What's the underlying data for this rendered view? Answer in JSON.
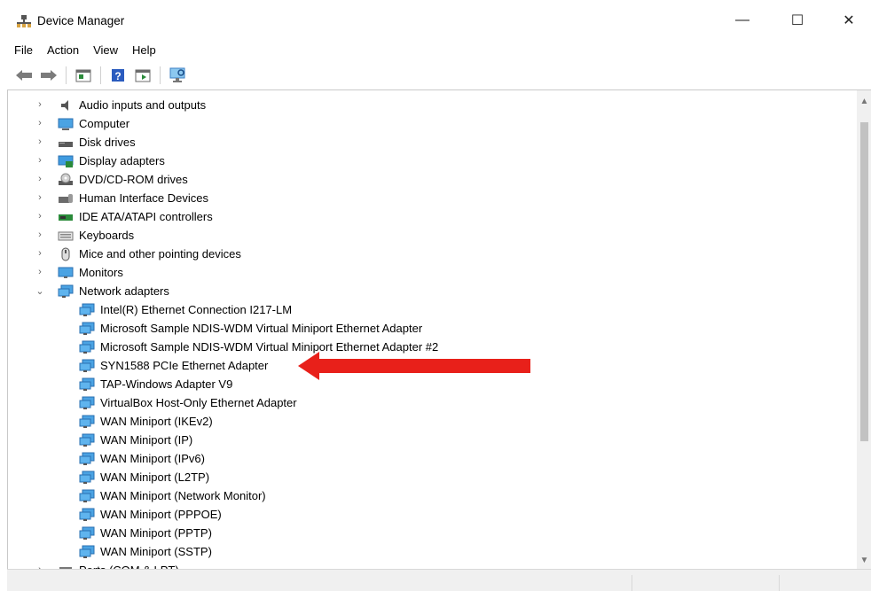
{
  "window": {
    "title": "Device Manager",
    "controls": {
      "minimize": "—",
      "maximize": "☐",
      "close": "✕"
    }
  },
  "menu": [
    "File",
    "Action",
    "View",
    "Help"
  ],
  "toolbar": {
    "buttons": [
      "back-icon",
      "forward-icon",
      "properties-icon",
      "help-icon",
      "update-driver-icon",
      "scan-hardware-icon"
    ]
  },
  "tree": {
    "categories": [
      {
        "label": "Audio inputs and outputs",
        "icon": "speaker-icon",
        "expanded": false
      },
      {
        "label": "Computer",
        "icon": "computer-icon",
        "expanded": false
      },
      {
        "label": "Disk drives",
        "icon": "disk-drive-icon",
        "expanded": false
      },
      {
        "label": "Display adapters",
        "icon": "display-adapter-icon",
        "expanded": false
      },
      {
        "label": "DVD/CD-ROM drives",
        "icon": "dvd-drive-icon",
        "expanded": false
      },
      {
        "label": "Human Interface Devices",
        "icon": "hid-icon",
        "expanded": false
      },
      {
        "label": "IDE ATA/ATAPI controllers",
        "icon": "ide-controller-icon",
        "expanded": false
      },
      {
        "label": "Keyboards",
        "icon": "keyboard-icon",
        "expanded": false
      },
      {
        "label": "Mice and other pointing devices",
        "icon": "mouse-icon",
        "expanded": false
      },
      {
        "label": "Monitors",
        "icon": "monitor-icon",
        "expanded": false
      },
      {
        "label": "Network adapters",
        "icon": "network-adapter-icon",
        "expanded": true
      }
    ],
    "network_adapters": [
      "Intel(R) Ethernet Connection I217-LM",
      "Microsoft Sample NDIS-WDM Virtual Miniport Ethernet Adapter",
      "Microsoft Sample NDIS-WDM Virtual Miniport Ethernet Adapter #2",
      "SYN1588 PCIe Ethernet Adapter",
      "TAP-Windows Adapter V9",
      "VirtualBox Host-Only Ethernet Adapter",
      "WAN Miniport (IKEv2)",
      "WAN Miniport (IP)",
      "WAN Miniport (IPv6)",
      "WAN Miniport (L2TP)",
      "WAN Miniport (Network Monitor)",
      "WAN Miniport (PPPOE)",
      "WAN Miniport (PPTP)",
      "WAN Miniport (SSTP)"
    ],
    "after": {
      "label": "Ports (COM & LPT)",
      "icon": "port-icon",
      "expanded": false
    }
  },
  "annotation": {
    "target": "SYN1588 PCIe Ethernet Adapter",
    "color": "#e8201a"
  },
  "colors": {
    "accent": "#1e78d2",
    "arrow": "#e8201a"
  }
}
